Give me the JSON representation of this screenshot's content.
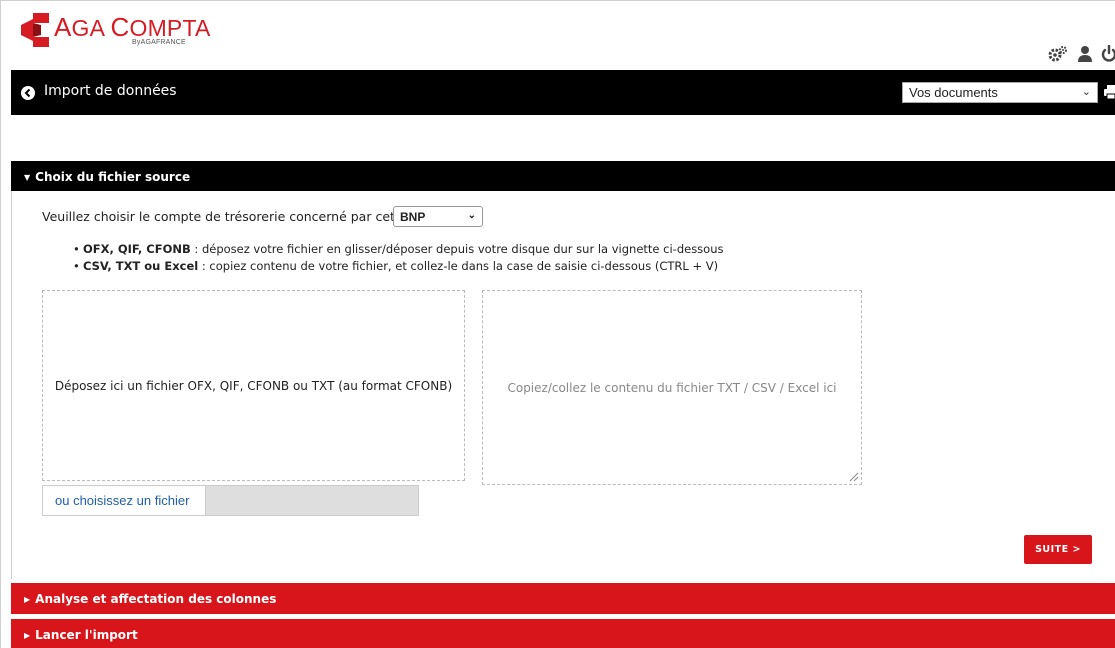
{
  "logo": {
    "name_part1": "A",
    "name_part2": "GA ",
    "name_part3": "C",
    "name_part4": "OMPTA",
    "subtitle": "ByAGAFRANCE"
  },
  "header": {
    "title": "Import de données",
    "documents_select": {
      "selected": "Vos documents"
    }
  },
  "sections": {
    "source": {
      "title": "Choix du fichier source",
      "choose_label": "Veuillez choisir le compte de trésorerie concerné par cet import :",
      "account_select": {
        "selected": "BNP"
      },
      "bullets": [
        {
          "bold": "OFX, QIF, CFONB",
          "text": " : déposez votre fichier en glisser/déposer depuis votre disque dur sur la vignette ci-dessous"
        },
        {
          "bold": "CSV, TXT ou Excel",
          "text": " : copiez contenu de votre fichier, et collez-le dans la case de saisie ci-dessous (CTRL + V)"
        }
      ],
      "drop_zone_text": "Déposez ici un fichier OFX, QIF, CFONB ou TXT (au format CFONB)",
      "paste_placeholder": "Copiez/collez le contenu du fichier TXT / CSV / Excel ici",
      "file_button": "ou choisissez un fichier",
      "next_button": "SUITE >"
    },
    "columns": {
      "title": "Analyse et affectation des colonnes"
    },
    "launch": {
      "title": "Lancer l'import"
    }
  },
  "colors": {
    "brand_red": "#d7151b",
    "bar_black": "#000000",
    "link_blue": "#1f5fa8"
  },
  "icons": {
    "settings": "gears-icon",
    "user": "user-icon",
    "power": "power-icon",
    "back": "circle-arrow-left-icon",
    "print": "printer-icon"
  }
}
